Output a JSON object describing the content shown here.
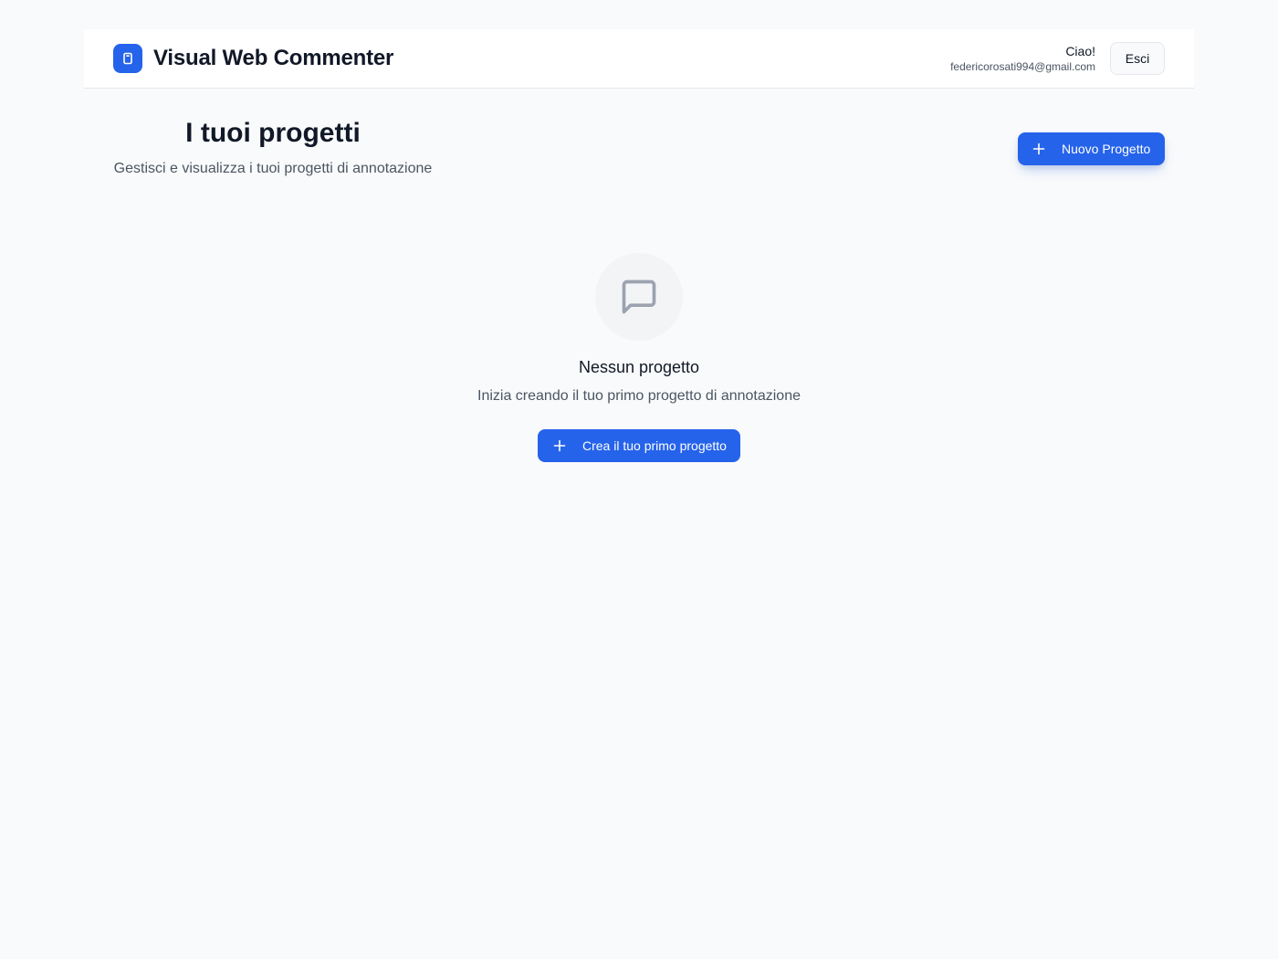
{
  "header": {
    "app_title": "Visual Web Commenter",
    "logo_icon": "document-icon",
    "greeting": "Ciao!",
    "user_email": "federicorosati994@gmail.com",
    "logout_label": "Esci"
  },
  "page": {
    "title": "I tuoi progetti",
    "subtitle": "Gestisci e visualizza i tuoi progetti di annotazione",
    "new_project_label": "Nuovo Progetto",
    "new_project_icon": "plus-icon"
  },
  "empty_state": {
    "icon": "message-square-icon",
    "title": "Nessun progetto",
    "description": "Inizia creando il tuo primo progetto di annotazione",
    "cta_label": "Crea il tuo primo progetto",
    "cta_icon": "plus-icon"
  },
  "colors": {
    "accent": "#2563eb",
    "background": "#f9fafb",
    "surface": "#ffffff",
    "text_primary": "#111827",
    "text_secondary": "#4b5563",
    "icon_muted": "#9ca3af"
  }
}
